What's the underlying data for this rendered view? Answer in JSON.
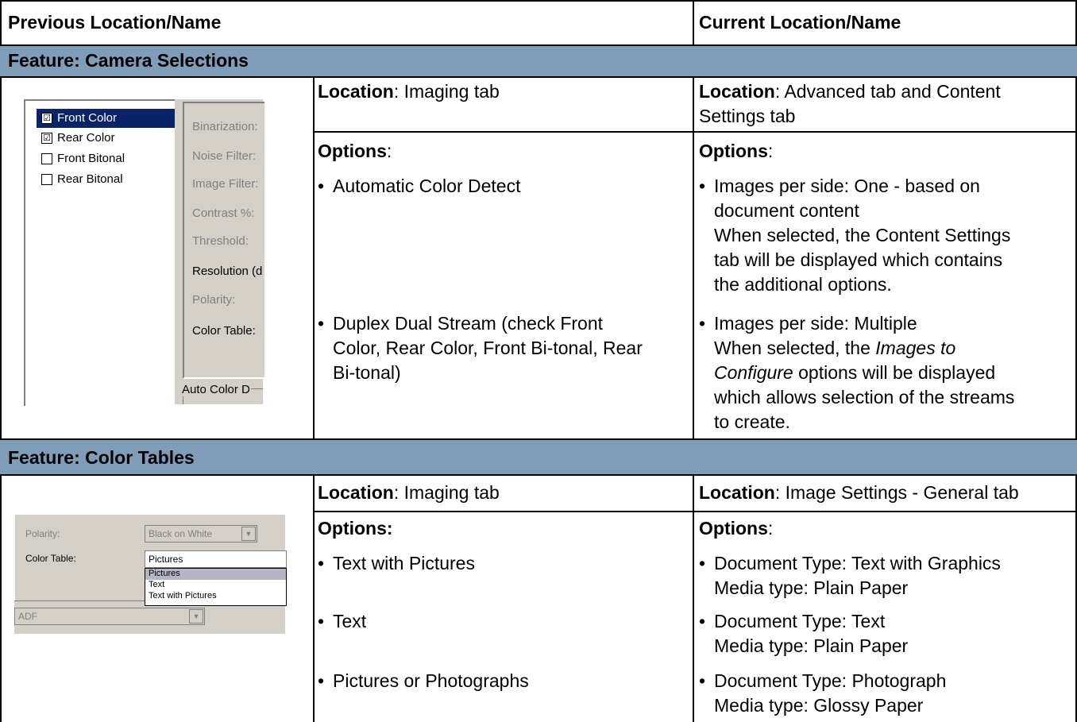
{
  "header": {
    "previous": "Previous Location/Name",
    "current": "Current Location/Name"
  },
  "sections": [
    {
      "feature": "Feature: Camera Selections",
      "old_location_label": "Location",
      "old_location_value": ": Imaging tab",
      "new_location_label": "Location",
      "new_location_value": ": Advanced tab and Content",
      "new_location_value2": "Settings tab",
      "old_options_label": "Options",
      "old_options_suffix": ":",
      "new_options_label": "Options",
      "new_options_suffix": ":",
      "old_options": [
        "Automatic Color Detect",
        "Duplex Dual Stream (check Front",
        "Color, Rear Color, Front Bi-tonal, Rear",
        "Bi-tonal)"
      ],
      "new_options": [
        "Images per side: One - based on",
        "document content",
        "When selected, the Content Settings",
        "tab will be displayed which contains",
        "the additional options.",
        "Images per side: Multiple",
        "When selected, the",
        "Images to",
        "Configure",
        "options will be displayed",
        "which allows selection of the streams",
        "to create."
      ],
      "screenshot": {
        "items": [
          {
            "label": "Front Color",
            "checked": true,
            "selected": true
          },
          {
            "label": "Rear Color",
            "checked": true,
            "selected": false
          },
          {
            "label": "Front Bitonal",
            "checked": false,
            "selected": false
          },
          {
            "label": "Rear Bitonal",
            "checked": false,
            "selected": false
          }
        ],
        "fields": [
          "Binarization:",
          "Noise Filter:",
          "Image Filter:",
          "Contrast %:",
          "Threshold:",
          "Resolution (d",
          "Polarity:",
          "Color Table:",
          "Auto Color D"
        ],
        "check_glyph": "☑",
        "uncheck_glyph": "☐"
      }
    },
    {
      "feature": "Feature: Color Tables",
      "old_location_label": "Location",
      "old_location_value": ": Imaging tab",
      "new_location_label": "Location",
      "new_location_value": ": Image Settings - General tab",
      "old_options_label": "Options:",
      "new_options_label": "Options",
      "new_options_suffix": ":",
      "old_options": [
        "Text with Pictures",
        "Text",
        "Pictures or Photographs"
      ],
      "new_options": [
        "Document Type: Text with Graphics",
        "Media type: Plain Paper",
        "Document Type: Text",
        "Media type: Plain Paper",
        "Document Type: Photograph",
        "Media type: Glossy Paper"
      ],
      "screenshot": {
        "polarity_label": "Polarity:",
        "polarity_value": "Black on White",
        "color_table_label": "Color Table:",
        "color_table_value": "Pictures",
        "dropdown_items": [
          "Pictures",
          "Text",
          "Text with Pictures"
        ],
        "source_value": "ADF",
        "arrow_glyph": "▼"
      }
    }
  ],
  "bullet": "•",
  "colors": {
    "band": "#7f9db9",
    "selection": "#0a246a",
    "dialog": "#d4d0c8"
  }
}
